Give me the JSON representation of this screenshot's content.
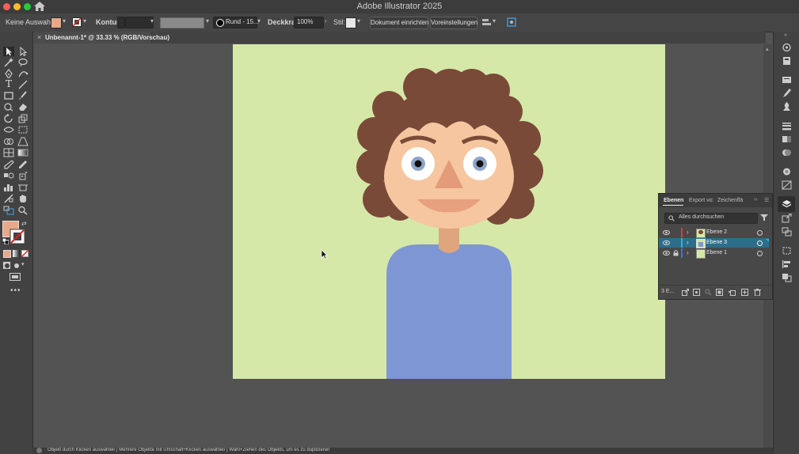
{
  "app": {
    "title": "Adobe Illustrator 2025",
    "traffic_colors": [
      "#fe5f57",
      "#febc2e",
      "#28c840"
    ]
  },
  "controlbar": {
    "selection_label": "Keine Auswahl",
    "fill_color": "#e8a88a",
    "kontur_label": "Kontur:",
    "brush_label": "Rund - 15...",
    "deckkraft_label": "Deckkraft:",
    "deckkraft_value": "100%",
    "stil_label": "Stil:",
    "doc_setup_button": "Dokument einrichten",
    "preferences_button": "Voreinstellungen"
  },
  "document": {
    "tab_label": "Unbenannt-1* @ 33.33 % (RGB/Vorschau)",
    "close_glyph": "×"
  },
  "artboard": {
    "background": "#d5e8a8",
    "illustration": {
      "hair_color": "#7a4a38",
      "skin_color": "#f5c6a0",
      "neck_color": "#dfa67e",
      "eye_white": "#ffffff",
      "iris_color": "#8fa5c8",
      "pupil_color": "#111111",
      "nose_color": "#e39b7a",
      "mouth_color": "#e8a07e",
      "shirt_color": "#7f96d4"
    }
  },
  "layers_panel": {
    "tabs": [
      "Ebenen",
      "Export vo:",
      "Zeichenflä"
    ],
    "search_placeholder": "Alles durchsuchen",
    "layers": [
      {
        "name": "Ebene 2",
        "color": "#e0383e",
        "selected": false
      },
      {
        "name": "Ebene 3",
        "color": "#2ab4d8",
        "selected": true
      },
      {
        "name": "Ebene 1",
        "color": "#3e6fe0",
        "selected": false
      }
    ],
    "layer_count": "3 E...",
    "selected_row_color": "#2c6e8a"
  },
  "statusbar": {
    "text": "Objekt durch Klicken auswählen  |  Mehrere Objekte mit Umschalt+Klicken auswählen  |  Wahl+Ziehen des Objekts, um es zu duplizieren"
  }
}
